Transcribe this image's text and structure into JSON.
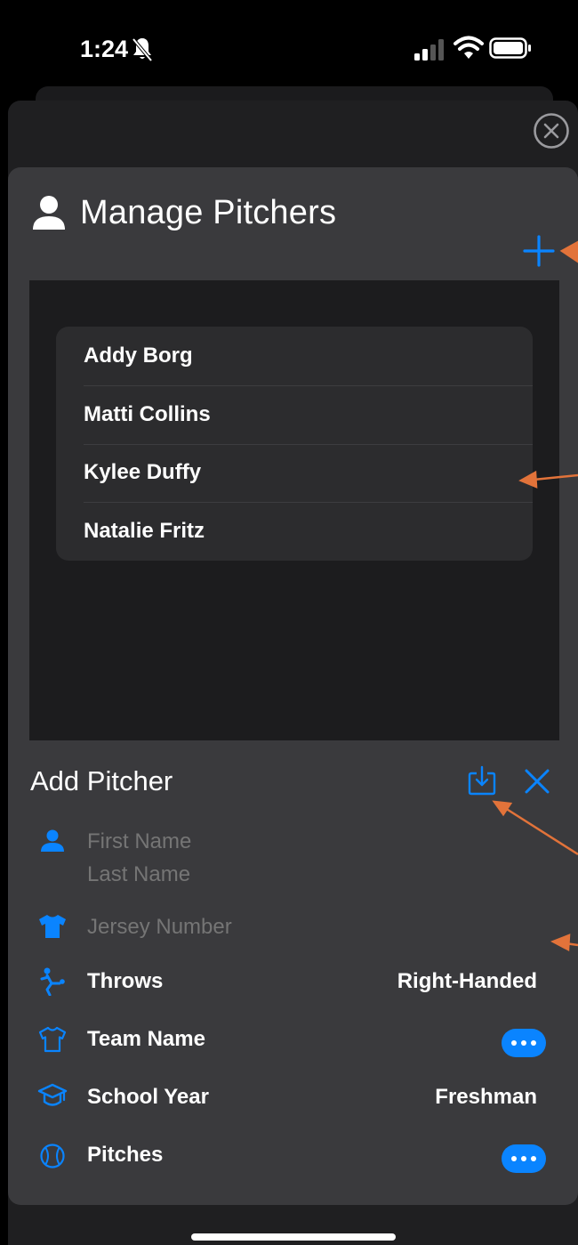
{
  "status_bar": {
    "time": "1:24"
  },
  "header": {
    "title": "Manage Pitchers"
  },
  "pitchers": [
    {
      "name": "Addy Borg"
    },
    {
      "name": "Matti Collins"
    },
    {
      "name": "Kylee Duffy"
    },
    {
      "name": "Natalie Fritz"
    }
  ],
  "form": {
    "title": "Add Pitcher",
    "first_name_placeholder": "First Name",
    "last_name_placeholder": "Last Name",
    "jersey_placeholder": "Jersey Number",
    "throws_label": "Throws",
    "throws_value": "Right-Handed",
    "team_label": "Team Name",
    "school_year_label": "School Year",
    "school_year_value": "Freshman",
    "pitches_label": "Pitches"
  },
  "colors": {
    "accent": "#0a84ff",
    "annotation_arrow": "#e2733a",
    "panel": "#3a3a3d",
    "list_background": "#1c1c1e",
    "list_card": "#2c2c2e"
  },
  "icons": [
    "bell-slash-icon",
    "cellular-signal-icon",
    "wifi-icon",
    "battery-icon",
    "close-circle-icon",
    "person-icon",
    "plus-icon",
    "save-download-icon",
    "xmark-icon",
    "jersey-icon",
    "pitcher-icon",
    "shirt-icon",
    "graduation-cap-icon",
    "softball-icon"
  ]
}
